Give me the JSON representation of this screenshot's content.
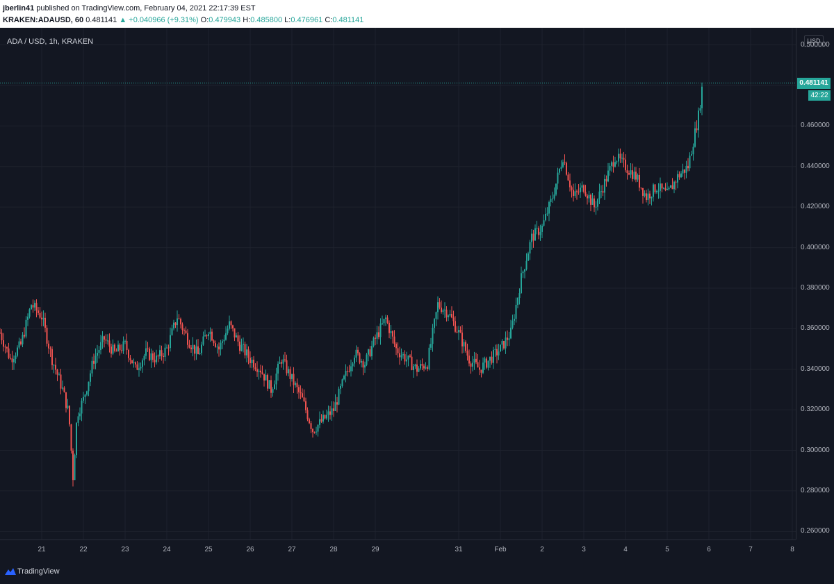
{
  "publish": {
    "author": "jberlin41",
    "text": " published on TradingView.com, February 04, 2021 22:17:39 EST"
  },
  "ohlc": {
    "symbol": "KRAKEN:ADAUSD, 60",
    "last": "0.481141",
    "change": "▲ +0.040966 (+9.31%)",
    "o_label": "O:",
    "o": "0.479943",
    "h_label": "H:",
    "h": "0.485800",
    "l_label": "L:",
    "l": "0.476961",
    "c_label": "C:",
    "c": "0.481141"
  },
  "chart_title": "ADA / USD, 1h, KRAKEN",
  "currency_badge": "USD",
  "last_price_label": "0.481141",
  "countdown": "42:22",
  "brand": "TradingView",
  "colors": {
    "up": "#26a69a",
    "down": "#ef5350",
    "background": "#131722",
    "grid": "#1e222d"
  },
  "chart_data": {
    "type": "candlestick",
    "title": "ADA / USD, 1h, KRAKEN",
    "y_tick_labels": [
      "0.500000",
      "0.480000",
      "0.460000",
      "0.440000",
      "0.420000",
      "0.400000",
      "0.380000",
      "0.360000",
      "0.340000",
      "0.320000",
      "0.300000",
      "0.280000",
      "0.260000"
    ],
    "ylim": [
      0.256,
      0.505
    ],
    "x_tick_labels": [
      "21",
      "22",
      "23",
      "24",
      "25",
      "26",
      "27",
      "28",
      "29",
      "31",
      "Feb",
      "2",
      "3",
      "4",
      "5",
      "6",
      "7",
      "8"
    ],
    "last_price": 0.481141,
    "grid": true,
    "close_path": [
      [
        20.0,
        0.358
      ],
      [
        20.25,
        0.345
      ],
      [
        20.5,
        0.352
      ],
      [
        20.75,
        0.372
      ],
      [
        21.0,
        0.366
      ],
      [
        21.25,
        0.345
      ],
      [
        21.5,
        0.33
      ],
      [
        21.65,
        0.318
      ],
      [
        21.75,
        0.287
      ],
      [
        21.85,
        0.318
      ],
      [
        22.0,
        0.325
      ],
      [
        22.25,
        0.345
      ],
      [
        22.5,
        0.355
      ],
      [
        22.75,
        0.348
      ],
      [
        23.0,
        0.352
      ],
      [
        23.25,
        0.34
      ],
      [
        23.5,
        0.348
      ],
      [
        23.75,
        0.345
      ],
      [
        24.0,
        0.35
      ],
      [
        24.25,
        0.366
      ],
      [
        24.5,
        0.355
      ],
      [
        24.75,
        0.347
      ],
      [
        25.0,
        0.36
      ],
      [
        25.25,
        0.35
      ],
      [
        25.5,
        0.362
      ],
      [
        25.75,
        0.352
      ],
      [
        26.0,
        0.345
      ],
      [
        26.25,
        0.34
      ],
      [
        26.5,
        0.33
      ],
      [
        26.75,
        0.345
      ],
      [
        27.0,
        0.335
      ],
      [
        27.25,
        0.325
      ],
      [
        27.5,
        0.31
      ],
      [
        27.75,
        0.315
      ],
      [
        28.0,
        0.32
      ],
      [
        28.25,
        0.335
      ],
      [
        28.5,
        0.348
      ],
      [
        28.75,
        0.343
      ],
      [
        29.0,
        0.355
      ],
      [
        29.25,
        0.365
      ],
      [
        29.5,
        0.35
      ],
      [
        29.75,
        0.345
      ],
      [
        30.0,
        0.34
      ],
      [
        30.25,
        0.343
      ],
      [
        30.5,
        0.372
      ],
      [
        30.75,
        0.368
      ],
      [
        31.0,
        0.358
      ],
      [
        31.25,
        0.345
      ],
      [
        31.5,
        0.34
      ],
      [
        31.75,
        0.345
      ],
      [
        32.0,
        0.35
      ],
      [
        32.25,
        0.358
      ],
      [
        32.5,
        0.385
      ],
      [
        32.75,
        0.405
      ],
      [
        33.0,
        0.41
      ],
      [
        33.25,
        0.425
      ],
      [
        33.5,
        0.445
      ],
      [
        33.75,
        0.425
      ],
      [
        34.0,
        0.43
      ],
      [
        34.25,
        0.42
      ],
      [
        34.5,
        0.432
      ],
      [
        34.75,
        0.445
      ],
      [
        35.0,
        0.44
      ],
      [
        35.25,
        0.435
      ],
      [
        35.5,
        0.425
      ],
      [
        35.75,
        0.43
      ],
      [
        36.0,
        0.426
      ],
      [
        36.25,
        0.435
      ],
      [
        36.5,
        0.44
      ],
      [
        36.75,
        0.465
      ],
      [
        36.85,
        0.481141
      ]
    ]
  }
}
